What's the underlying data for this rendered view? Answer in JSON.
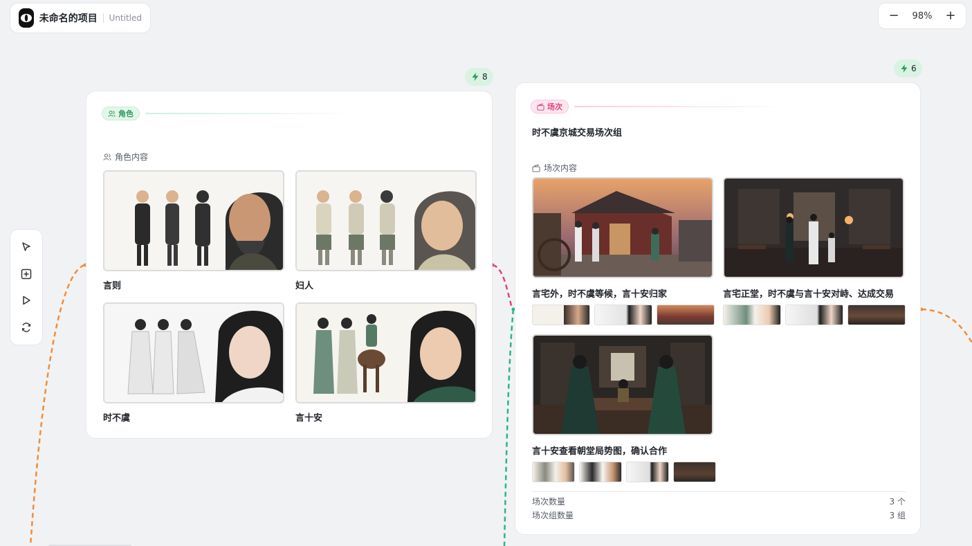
{
  "project": {
    "name": "未命名的项目",
    "subtitle": "Untitled"
  },
  "zoom": {
    "minus": "−",
    "value": "98%",
    "plus": "+"
  },
  "toolbar": {
    "tools": [
      "pointer-icon",
      "add-node-icon",
      "play-icon",
      "refresh-icon"
    ]
  },
  "characters_card": {
    "badge_count": "8",
    "tag_label": "角色",
    "section_label": "角色内容",
    "items": [
      {
        "name": "言则"
      },
      {
        "name": "妇人"
      },
      {
        "name": "时不虞"
      },
      {
        "name": "言十安"
      }
    ]
  },
  "scenes_card": {
    "badge_count": "6",
    "tag_label": "场次",
    "title": "时不虞京城交易场次组",
    "section_label": "场次内容",
    "scenes": [
      {
        "title": "言宅外，时不虞等候，言十安归家"
      },
      {
        "title": "言宅正堂，时不虞与言十安对峙、达成交易"
      },
      {
        "title": "言十安查看朝堂局势图，确认合作"
      }
    ],
    "stats": [
      {
        "label": "场次数量",
        "value": "3 个"
      },
      {
        "label": "场次组数量",
        "value": "3 组"
      }
    ]
  },
  "colors": {
    "accent_green": "#2f9a62",
    "accent_pink": "#e0457a",
    "connector_orange": "#f28c38",
    "connector_teal": "#2bb38a",
    "connector_pink": "#e0457a"
  }
}
